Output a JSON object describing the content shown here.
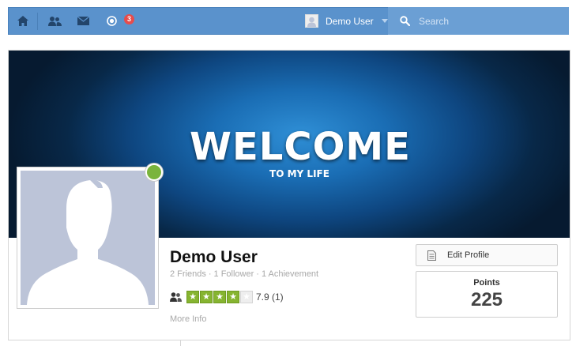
{
  "topbar": {
    "icons": [
      "home-icon",
      "friends-icon",
      "messages-icon",
      "notifications-icon"
    ],
    "notification_count": "3",
    "user_name": "Demo User",
    "search_placeholder": "Search"
  },
  "cover": {
    "title": "WELCOME",
    "subtitle": "TO MY LIFE"
  },
  "profile": {
    "name": "Demo User",
    "friends": "2 Friends",
    "followers": "1 Follower",
    "achievements": "1 Achievement",
    "separator": "·",
    "rating_value": "7.9 (1)",
    "stars_filled": 4,
    "stars_total": 5,
    "more_info": "More Info"
  },
  "actions": {
    "edit_profile": "Edit Profile",
    "points_label": "Points",
    "points_value": "225"
  },
  "colors": {
    "topbar": "#5a92cc",
    "search_bg": "#6b9fd4",
    "online": "#7ab43c",
    "star_on": "#86b430",
    "badge": "#e74c4c"
  }
}
